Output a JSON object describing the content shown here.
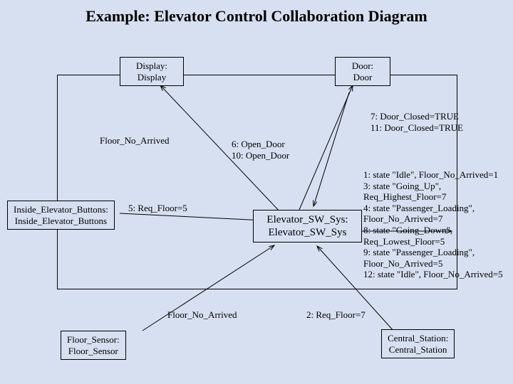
{
  "title": "Example: Elevator Control Collaboration Diagram",
  "boxes": {
    "display": "Display:\nDisplay",
    "door": "Door:\nDoor",
    "buttons": "Inside_Elevator_Buttons:\nInside_Elevator_Buttons",
    "swsys": "Elevator_SW_Sys:\nElevator_SW_Sys",
    "sensor": "Floor_Sensor:\nFloor_Sensor",
    "central": "Central_Station:\nCentral_Station"
  },
  "labels": {
    "floor_no_arrived_top": "Floor_No_Arrived",
    "open_door": "6:  Open_Door\n10: Open_Door",
    "door_closed": "7:  Door_Closed=TRUE\n11: Door_Closed=TRUE",
    "req_floor_5": "5: Req_Floor=5",
    "states": "1: state \"Idle\", Floor_No_Arrived=1\n3: state \"Going_Up\",\n            Req_Highest_Floor=7\n4: state \"Passenger_Loading\",\n            Floor_No_Arrived=7\n8: state \"Going_Down\",\n            Req_Lowest_Floor=5\n9: state \"Passenger_Loading\",\n            Floor_No_Arrived=5\n12: state \"Idle\", Floor_No_Arrived=5",
    "floor_no_arrived_bottom": "Floor_No_Arrived",
    "req_floor_7": "2: Req_Floor=7"
  }
}
